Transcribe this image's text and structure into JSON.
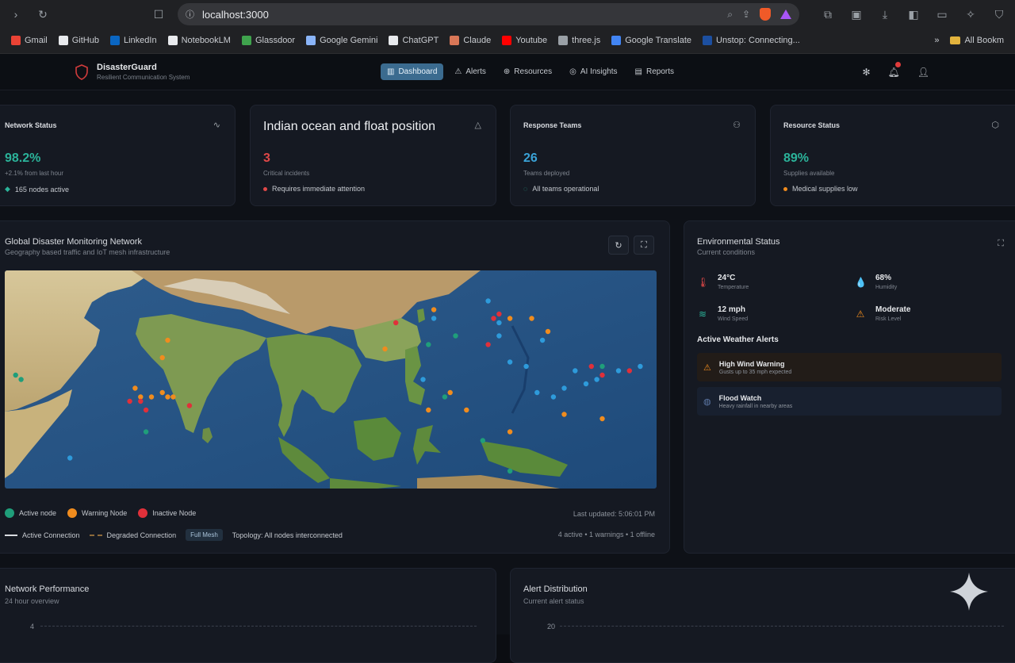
{
  "browser": {
    "url": "localhost:3000",
    "bookmarks": [
      "Gmail",
      "GitHub",
      "LinkedIn",
      "NotebookLM",
      "Glassdoor",
      "Google Gemini",
      "ChatGPT",
      "Claude",
      "Youtube",
      "three.js",
      "Google Translate",
      "Unstop: Connecting..."
    ],
    "bookmark_colors": [
      "#ea4335",
      "#e8eaed",
      "#0a66c2",
      "#e8eaed",
      "#3fa34d",
      "#8ab4f8",
      "#e8eaed",
      "#d97757",
      "#ff0000",
      "#9aa0a6",
      "#4285f4",
      "#1c4fa0"
    ],
    "more": "»",
    "all_bookmarks": "All Bookm"
  },
  "app": {
    "brand": {
      "title": "DisasterGuard",
      "subtitle": "Resilient Communication System"
    },
    "nav": [
      {
        "label": "Dashboard",
        "icon": "bar-chart-icon",
        "glyph": "▥",
        "active": true
      },
      {
        "label": "Alerts",
        "icon": "warning-icon",
        "glyph": "⚠"
      },
      {
        "label": "Resources",
        "icon": "globe-icon",
        "glyph": "⊕"
      },
      {
        "label": "AI Insights",
        "icon": "brain-icon",
        "glyph": "◎"
      },
      {
        "label": "Reports",
        "icon": "document-icon",
        "glyph": "▤"
      }
    ]
  },
  "stats": {
    "network": {
      "title": "Network Status",
      "value": "98.2%",
      "sub": "+2.1% from last hour",
      "foot": "165 nodes active",
      "color": "#2bb39a"
    },
    "middle": {
      "title": "Indian ocean and float position",
      "value": "3",
      "sub": "Critical incidents",
      "foot": "Requires immediate attention",
      "color": "#e04848"
    },
    "teams": {
      "title": "Response Teams",
      "value": "26",
      "sub": "Teams deployed",
      "foot": "All teams operational",
      "color": "#3aa3d8"
    },
    "resources": {
      "title": "Resource Status",
      "value": "89%",
      "sub": "Supplies available",
      "foot": "Medical supplies low",
      "color": "#2bb39a"
    }
  },
  "map_panel": {
    "title": "Global Disaster Monitoring Network",
    "subtitle": "Geography based traffic and IoT mesh infrastructure",
    "legend": {
      "active": "Active node",
      "warning": "Warning Node",
      "inactive": "Inactive Node",
      "active_conn": "Active Connection",
      "degraded_conn": "Degraded Connection",
      "mesh_badge": "Full Mesh",
      "topology": "Topology: All nodes interconnected"
    },
    "last_updated": "Last updated: 5:06:01 PM",
    "counts": "4 active • 1 warnings • 1 offline",
    "colors": {
      "active": "#1f9e7a",
      "warning": "#f08c1e",
      "inactive": "#e0303a",
      "info": "#2e9bdb"
    },
    "nodes": [
      {
        "status": "active",
        "lng": 47,
        "lat": 11
      },
      {
        "status": "active",
        "lng": 48,
        "lat": 10
      },
      {
        "status": "warning",
        "lng": 75,
        "lat": 19
      },
      {
        "status": "warning",
        "lng": 74,
        "lat": 15
      },
      {
        "status": "warning",
        "lng": 69,
        "lat": 8
      },
      {
        "status": "warning",
        "lng": 70,
        "lat": 6
      },
      {
        "status": "warning",
        "lng": 72,
        "lat": 6
      },
      {
        "status": "warning",
        "lng": 74,
        "lat": 7
      },
      {
        "status": "warning",
        "lng": 75,
        "lat": 6
      },
      {
        "status": "warning",
        "lng": 76,
        "lat": 6
      },
      {
        "status": "inactive",
        "lng": 68,
        "lat": 5
      },
      {
        "status": "inactive",
        "lng": 70,
        "lat": 5
      },
      {
        "status": "inactive",
        "lng": 71,
        "lat": 3
      },
      {
        "status": "inactive",
        "lng": 79,
        "lat": 4
      },
      {
        "status": "active",
        "lng": 71,
        "lat": -2
      },
      {
        "status": "info",
        "lng": 57,
        "lat": -8
      },
      {
        "status": "warning",
        "lng": 124,
        "lat": 26
      },
      {
        "status": "inactive",
        "lng": 117,
        "lat": 23
      },
      {
        "status": "warning",
        "lng": 115,
        "lat": 17
      },
      {
        "status": "active",
        "lng": 123,
        "lat": 18
      },
      {
        "status": "active",
        "lng": 128,
        "lat": 20
      },
      {
        "status": "info",
        "lng": 124,
        "lat": 24
      },
      {
        "status": "active",
        "lng": 126,
        "lat": 6
      },
      {
        "status": "warning",
        "lng": 127,
        "lat": 7
      },
      {
        "status": "warning",
        "lng": 123,
        "lat": 3
      },
      {
        "status": "info",
        "lng": 122,
        "lat": 10
      },
      {
        "status": "warning",
        "lng": 130,
        "lat": 3
      },
      {
        "status": "active",
        "lng": 133,
        "lat": -4
      },
      {
        "status": "info",
        "lng": 134,
        "lat": 28
      },
      {
        "status": "inactive",
        "lng": 135,
        "lat": 24
      },
      {
        "status": "inactive",
        "lng": 136,
        "lat": 25
      },
      {
        "status": "info",
        "lng": 136,
        "lat": 23
      },
      {
        "status": "warning",
        "lng": 138,
        "lat": 24
      },
      {
        "status": "info",
        "lng": 136,
        "lat": 20
      },
      {
        "status": "inactive",
        "lng": 134,
        "lat": 18
      },
      {
        "status": "info",
        "lng": 138,
        "lat": 14
      },
      {
        "status": "warning",
        "lng": 142,
        "lat": 24
      },
      {
        "status": "info",
        "lng": 144,
        "lat": 19
      },
      {
        "status": "warning",
        "lng": 145,
        "lat": 21
      },
      {
        "status": "info",
        "lng": 141,
        "lat": 13
      },
      {
        "status": "info",
        "lng": 148,
        "lat": 8
      },
      {
        "status": "info",
        "lng": 150,
        "lat": 12
      },
      {
        "status": "inactive",
        "lng": 153,
        "lat": 13
      },
      {
        "status": "active",
        "lng": 155,
        "lat": 13
      },
      {
        "status": "inactive",
        "lng": 155,
        "lat": 11
      },
      {
        "status": "info",
        "lng": 154,
        "lat": 10
      },
      {
        "status": "info",
        "lng": 158,
        "lat": 12
      },
      {
        "status": "inactive",
        "lng": 160,
        "lat": 12
      },
      {
        "status": "info",
        "lng": 162,
        "lat": 13
      },
      {
        "status": "info",
        "lng": 152,
        "lat": 9
      },
      {
        "status": "info",
        "lng": 146,
        "lat": 6
      },
      {
        "status": "info",
        "lng": 143,
        "lat": 7
      },
      {
        "status": "warning",
        "lng": 148,
        "lat": 2
      },
      {
        "status": "warning",
        "lng": 138,
        "lat": -2
      },
      {
        "status": "warning",
        "lng": 155,
        "lat": 1
      },
      {
        "status": "active",
        "lng": 138,
        "lat": -11
      }
    ]
  },
  "environment": {
    "title": "Environmental Status",
    "subtitle": "Current conditions",
    "metrics": [
      {
        "value": "24°C",
        "label": "Temperature",
        "icon": "thermometer-icon",
        "glyph": "🌡",
        "color": "#e04848"
      },
      {
        "value": "68%",
        "label": "Humidity",
        "icon": "droplet-icon",
        "glyph": "💧",
        "color": "#3aa3d8"
      },
      {
        "value": "12 mph",
        "label": "Wind Speed",
        "icon": "wind-icon",
        "glyph": "≋",
        "color": "#2bb39a"
      },
      {
        "value": "Moderate",
        "label": "Risk Level",
        "icon": "warning-icon",
        "glyph": "⚠",
        "color": "#f08c1e"
      }
    ],
    "alerts_title": "Active Weather Alerts",
    "alerts": [
      {
        "title": "High Wind Warning",
        "sub": "Gusts up to 35 mph expected",
        "glyph": "⚠",
        "color": "#f08c1e",
        "bg": "#221c18"
      },
      {
        "title": "Flood Watch",
        "sub": "Heavy rainfall in nearby areas",
        "glyph": "◍",
        "color": "#5e79a8",
        "bg": "#18202f"
      }
    ]
  },
  "bottom": {
    "performance": {
      "title": "Network Performance",
      "subtitle": "24 hour overview",
      "ytop": "4"
    },
    "distribution": {
      "title": "Alert Distribution",
      "subtitle": "Current alert status",
      "ytop": "20"
    }
  }
}
